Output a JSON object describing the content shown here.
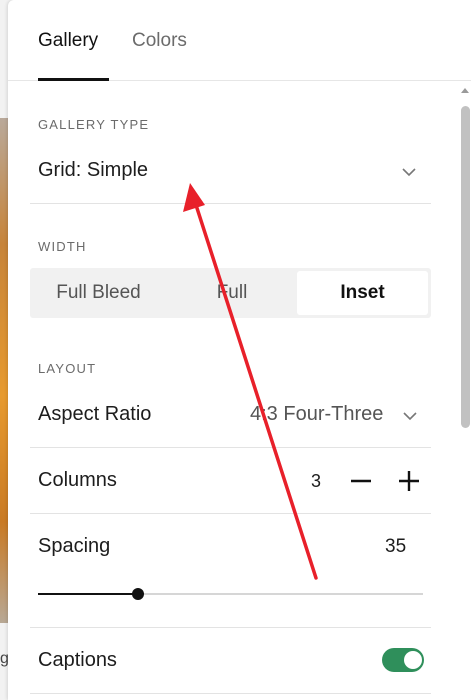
{
  "tabs": [
    {
      "label": "Gallery",
      "active": true
    },
    {
      "label": "Colors",
      "active": false
    }
  ],
  "gallery_type": {
    "section_label": "GALLERY TYPE",
    "value": "Grid: Simple",
    "icon": "chevron-down-icon"
  },
  "width": {
    "section_label": "WIDTH",
    "options": [
      "Full Bleed",
      "Full",
      "Inset"
    ],
    "selected": "Inset"
  },
  "layout": {
    "section_label": "LAYOUT",
    "aspect_ratio": {
      "label": "Aspect Ratio",
      "value": "4:3 Four-Three"
    },
    "columns": {
      "label": "Columns",
      "value": "3",
      "decrement_icon": "minus-icon",
      "increment_icon": "plus-icon"
    },
    "spacing": {
      "label": "Spacing",
      "value": "35",
      "slider_fraction": 0.26
    }
  },
  "captions": {
    "label": "Captions",
    "enabled": true
  },
  "background": {
    "partial_text": "g"
  },
  "colors": {
    "toggle_on": "#2f8f5b",
    "annotation_arrow": "#e8202a",
    "text_primary": "#1d1d1d",
    "text_secondary": "#6b6b6b"
  }
}
